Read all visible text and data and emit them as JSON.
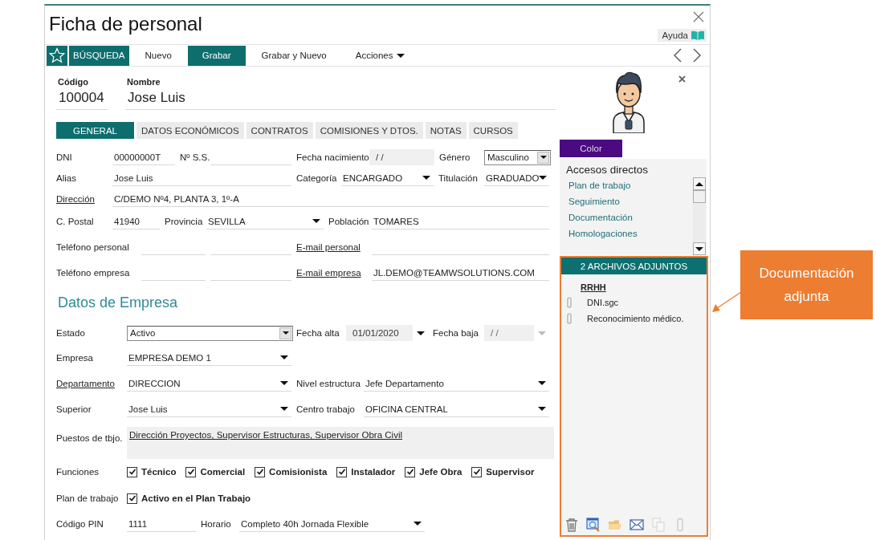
{
  "window": {
    "title": "Ficha de personal",
    "help": "Ayuda"
  },
  "toolbar": {
    "search": "BÚSQUEDA",
    "buttons": [
      {
        "label": "Nuevo",
        "selected": false,
        "kind": "plain"
      },
      {
        "label": "Grabar",
        "selected": true,
        "kind": "plain"
      },
      {
        "label": "Grabar y Nuevo",
        "selected": false,
        "kind": "plain"
      },
      {
        "label": "Acciones",
        "selected": false,
        "kind": "menu"
      }
    ]
  },
  "header": {
    "code_label": "Código",
    "code": "100004",
    "name_label": "Nombre",
    "name": "Jose Luis"
  },
  "tabs": [
    {
      "label": "GENERAL",
      "selected": true
    },
    {
      "label": "DATOS ECONÓMICOS",
      "selected": false
    },
    {
      "label": "CONTRATOS",
      "selected": false
    },
    {
      "label": "COMISIONES Y DTOS.",
      "selected": false
    },
    {
      "label": "NOTAS",
      "selected": false
    },
    {
      "label": "CURSOS",
      "selected": false
    }
  ],
  "rows": [
    {
      "cells": [
        {
          "kind": "label",
          "text": "DNI",
          "link": false
        },
        {
          "kind": "text",
          "value": "00000000T"
        },
        {
          "kind": "label",
          "text": "Nº S.S.",
          "link": false
        },
        {
          "kind": "text"
        },
        {
          "kind": "label",
          "text": "Fecha nacimiento",
          "link": false
        },
        {
          "kind": "date",
          "value": "/ /"
        },
        {
          "kind": "label",
          "text": "Género",
          "link": false
        },
        {
          "kind": "combo",
          "value": "Masculino"
        }
      ]
    },
    {
      "cells": [
        {
          "kind": "label",
          "text": "Alias",
          "link": false
        },
        {
          "kind": "text",
          "value": "Jose Luis"
        },
        {
          "kind": "label",
          "text": "Categoría",
          "link": false
        },
        {
          "kind": "select",
          "value": "ENCARGADO"
        },
        {
          "kind": "label",
          "text": "Titulación",
          "link": false
        },
        {
          "kind": "select",
          "value": "GRADUADO"
        }
      ]
    },
    {
      "cells": [
        {
          "kind": "label",
          "text": "Dirección",
          "link": true
        },
        {
          "kind": "text",
          "value": "C/DEMO Nº4, PLANTA 3, 1º-A"
        }
      ]
    },
    {
      "cells": [
        {
          "kind": "label",
          "text": "C. Postal",
          "link": false
        },
        {
          "kind": "text",
          "value": "41940"
        },
        {
          "kind": "label",
          "text": "Provincia",
          "link": false
        },
        {
          "kind": "select",
          "value": "SEVILLA"
        },
        {
          "kind": "label",
          "text": "Población",
          "link": false
        },
        {
          "kind": "text",
          "value": "TOMARES"
        }
      ]
    },
    {
      "cells": [
        {
          "kind": "label",
          "text": "Teléfono personal",
          "link": false
        },
        {
          "kind": "text"
        },
        {
          "kind": "text"
        },
        {
          "kind": "label",
          "text": "E-mail personal",
          "link": true
        },
        {
          "kind": "text"
        }
      ]
    },
    {
      "cells": [
        {
          "kind": "label",
          "text": "Teléfono empresa",
          "link": false
        },
        {
          "kind": "text"
        },
        {
          "kind": "text"
        },
        {
          "kind": "label",
          "text": "E-mail empresa",
          "link": true
        },
        {
          "kind": "text",
          "value": "JL.DEMO@TEAMWSOLUTIONS.COM"
        }
      ]
    },
    {
      "cells": [
        {
          "kind": "heading",
          "text": "Datos de Empresa"
        }
      ]
    },
    {
      "cells": [
        {
          "kind": "label",
          "text": "Estado",
          "link": false
        },
        {
          "kind": "combo",
          "value": "Activo"
        },
        {
          "kind": "label",
          "text": "Fecha alta",
          "link": false
        },
        {
          "kind": "date-select",
          "value": "01/01/2020",
          "disabled": false
        },
        {
          "kind": "label",
          "text": "Fecha baja",
          "link": false
        },
        {
          "kind": "date-select",
          "value": "/ /",
          "disabled": true
        }
      ]
    },
    {
      "cells": [
        {
          "kind": "label",
          "text": "Empresa",
          "link": false
        },
        {
          "kind": "select",
          "value": "EMPRESA DEMO 1"
        }
      ]
    },
    {
      "cells": [
        {
          "kind": "label",
          "text": "Departamento",
          "link": true
        },
        {
          "kind": "select",
          "value": "DIRECCION"
        },
        {
          "kind": "label",
          "text": "Nivel estructura",
          "link": false
        },
        {
          "kind": "select",
          "value": "Jefe Departamento"
        }
      ]
    },
    {
      "cells": [
        {
          "kind": "label",
          "text": "Superior",
          "link": false
        },
        {
          "kind": "select",
          "value": "Jose Luis"
        },
        {
          "kind": "label",
          "text": "Centro trabajo",
          "link": false
        },
        {
          "kind": "select",
          "value": "OFICINA CENTRAL"
        }
      ]
    },
    {
      "cells": [
        {
          "kind": "label",
          "text": "Puestos de tbjo.",
          "link": false
        },
        {
          "kind": "area",
          "value": "Dirección Proyectos, Supervisor Estructuras, Supervisor Obra Civil"
        }
      ]
    },
    {
      "cells": [
        {
          "kind": "label",
          "text": "Funciones",
          "link": false
        },
        {
          "kind": "checks",
          "items": [
            {
              "label": "Técnico",
              "checked": true
            },
            {
              "label": "Comercial",
              "checked": true
            },
            {
              "label": "Comisionista",
              "checked": true
            },
            {
              "label": "Instalador",
              "checked": true
            },
            {
              "label": "Jefe Obra",
              "checked": true
            },
            {
              "label": "Supervisor",
              "checked": true
            }
          ]
        }
      ]
    },
    {
      "cells": [
        {
          "kind": "label",
          "text": "Plan de trabajo",
          "link": false
        },
        {
          "kind": "checks",
          "items": [
            {
              "label": "Activo en el Plan Trabajo",
              "checked": true
            }
          ]
        }
      ]
    },
    {
      "cells": [
        {
          "kind": "label",
          "text": "Código PIN",
          "link": false
        },
        {
          "kind": "text",
          "value": "1111"
        },
        {
          "kind": "label",
          "text": "Horario",
          "link": false
        },
        {
          "kind": "select",
          "value": "Completo 40h Jornada Flexible"
        }
      ]
    }
  ],
  "side": {
    "color_button": "Color",
    "shortcuts": {
      "title": "Accesos directos",
      "items": [
        "Plan de trabajo",
        "Seguimiento",
        "Documentación",
        "Homologaciones"
      ]
    },
    "attachments": {
      "title": "2 ARCHIVOS ADJUNTOS",
      "groups": [
        {
          "name": "RRHH",
          "files": [
            "DNI.sgc",
            "Reconocimiento médico."
          ]
        }
      ],
      "tools": [
        {
          "kind": "trash",
          "disabled": false
        },
        {
          "kind": "preview",
          "disabled": false
        },
        {
          "kind": "folder",
          "disabled": false
        },
        {
          "kind": "mail",
          "disabled": false
        },
        {
          "kind": "copy",
          "disabled": true
        },
        {
          "kind": "clip",
          "disabled": true
        }
      ]
    }
  },
  "callout": {
    "text": "Documentación adjunta"
  }
}
